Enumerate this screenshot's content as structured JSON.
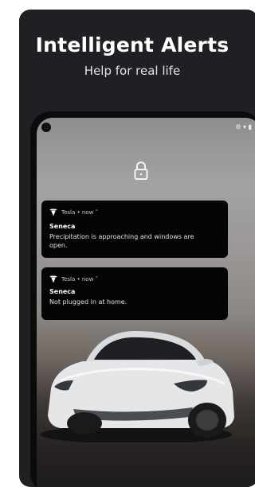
{
  "promo": {
    "title": "Intelligent Alerts",
    "subtitle": "Help for real life"
  },
  "lockscreen": {
    "status_icons": "⚙ ▾ ▮",
    "lock_icon": "padlock-icon"
  },
  "notifications": [
    {
      "app_icon": "tesla-logo-icon",
      "source": "Tesla • now ˅",
      "title": "Seneca",
      "body": "Precipitation is approaching and windows are open."
    },
    {
      "app_icon": "tesla-logo-icon",
      "source": "Tesla • now ˅",
      "title": "Seneca",
      "body": "Not plugged in at home."
    }
  ],
  "colors": {
    "card_background": "#1f2023",
    "notification_background": "#050505",
    "car_body": "#e4e6e8"
  }
}
